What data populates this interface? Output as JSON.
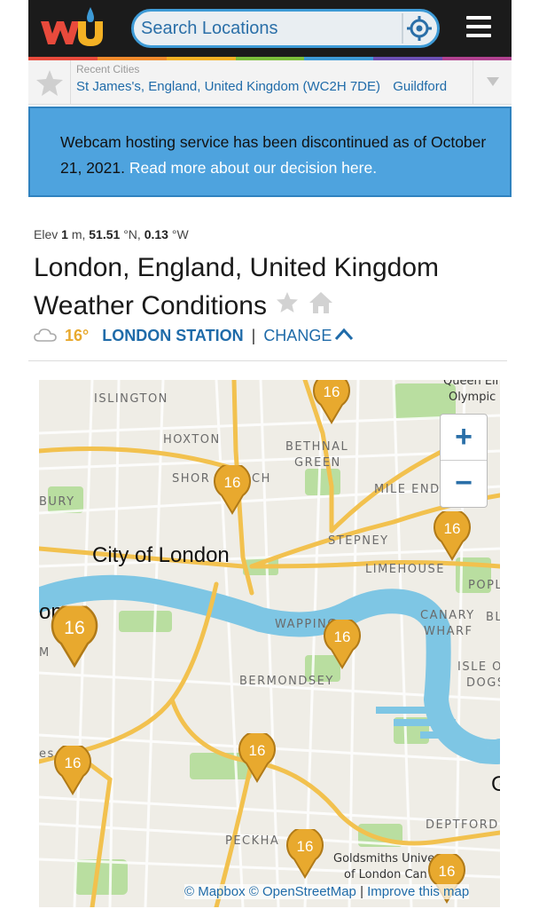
{
  "colors": {
    "header_bg": "#1b1b1b",
    "search_border": "#3d9ad6",
    "link_blue": "#1f6ba9",
    "notice_bg": "#4ea3de",
    "pin_gold": "#e8a92e",
    "water": "#7ec6e4",
    "road": "#f2c14e"
  },
  "header": {
    "logo": "wu",
    "search_placeholder": "Search Locations",
    "locate_icon": "crosshair-icon",
    "menu_icon": "hamburger-icon"
  },
  "recent": {
    "label": "Recent Cities",
    "cities": [
      "St James's, England, United Kingdom (WC2H 7DE)",
      "Guildford"
    ]
  },
  "notice": {
    "text": "Webcam hosting service has been discontinued as of October 21, 2021.",
    "link": "Read more about our decision here."
  },
  "location": {
    "elev_label": "Elev",
    "elev_value": "1",
    "elev_unit": "m,",
    "lat_value": "51.51",
    "lat_unit": "°N,",
    "lon_value": "0.13",
    "lon_unit": "°W",
    "title_main": "London, England, United Kingdom Weather",
    "title_tail": "Conditions"
  },
  "station": {
    "temp": "16°",
    "name": "LONDON STATION",
    "separator": "|",
    "change": "CHANGE"
  },
  "map": {
    "places": {
      "islington": "ISLINGTON",
      "hoxton": "HOXTON",
      "bethnal_green_1": "BETHNAL",
      "bethnal_green_2": "GREEN",
      "shoreditch_a": "SHOR",
      "shoreditch_b": "CH",
      "mile_end": "MILE END",
      "bury": "BURY",
      "stepney": "STEPNEY",
      "city": "City of London",
      "limehouse": "LIMEHOUSE",
      "popl": "POPL",
      "on": "on",
      "wapping": "WAPPING",
      "canary_1": "CANARY",
      "canary_b": "BL",
      "canary_2": "WHARF",
      "m": "M",
      "bermondsey": "BERMONDSEY",
      "isle_1": "ISLE O",
      "isle_2": "DOGS",
      "es": "es",
      "g": "G",
      "deptford": "DEPTFORD",
      "peckham": "PECKHA",
      "goldsmiths_1": "Goldsmiths Unive",
      "goldsmiths_2": "of London Can",
      "queen": "Queen Eli",
      "olympic": "Olympic"
    },
    "pins": [
      "16",
      "16",
      "16",
      "16",
      "16",
      "16",
      "16",
      "16",
      "16"
    ],
    "zoom_in": "+",
    "zoom_out": "−",
    "attribution_mapbox": "© Mapbox",
    "attribution_osm": "© OpenStreetMap",
    "attribution_separator": "|",
    "attribution_improve": "Improve this map"
  }
}
